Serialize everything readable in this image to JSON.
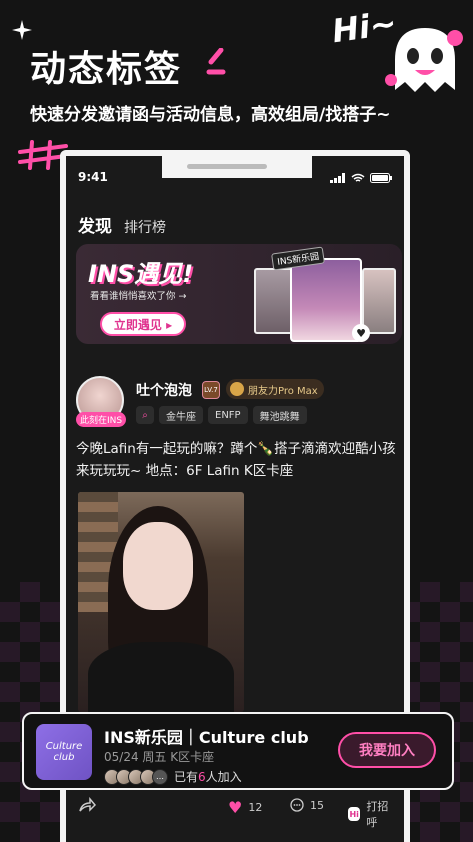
{
  "promo": {
    "headline": "动态标签",
    "subline": "快速分发邀请函与活动信息，高效组局/找搭子~",
    "hi": "Hi~"
  },
  "status": {
    "time": "9:41"
  },
  "tabs": [
    {
      "label": "发现",
      "active": true
    },
    {
      "label": "排行榜",
      "active": false
    }
  ],
  "banner": {
    "title": "INS遇见!",
    "subtitle": "看看谁悄悄喜欢了你 →",
    "button": "立即遇见 ▸",
    "tag": "INS新乐园"
  },
  "post": {
    "username": "吐个泡泡",
    "level": "LV.7",
    "friend_badge": "朋友力Pro Max",
    "here_badge": "此刻在INS",
    "tags": [
      "金牛座",
      "ENFP",
      "舞池跳舞"
    ],
    "text": "今晚Lafin有一起玩的嘛？蹲个🍾搭子滴滴欢迎酷小孩来玩玩玩~ 地点：6F Lafin K区卡座",
    "likes": "12",
    "comments": "15",
    "greet": "打招呼",
    "hi_icon": "Hi"
  },
  "club": {
    "logo_line1": "Culture",
    "logo_line2": "club",
    "title": "INS新乐园｜Culture club",
    "subtitle": "05/24 周五 K区卡座",
    "joined_prefix": "已有",
    "joined_count": "6",
    "joined_suffix": "人加入",
    "join_button": "我要加入"
  },
  "colors": {
    "accent": "#ff4fa8",
    "background": "#141414"
  }
}
